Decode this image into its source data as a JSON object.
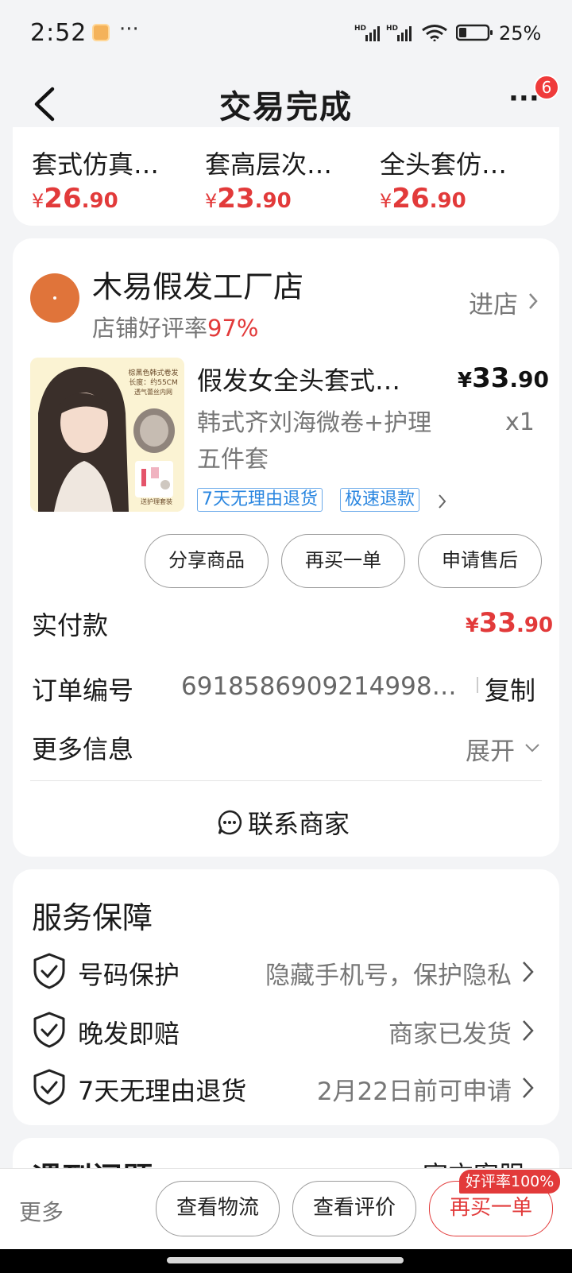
{
  "status_bar": {
    "time": "2:52",
    "overflow": "···",
    "network_1": "HD",
    "network_2": "HD",
    "battery": "25%"
  },
  "header": {
    "title": "交易完成",
    "more": "···",
    "badge_count": "6"
  },
  "recommendations": [
    {
      "name": "套式仿真…",
      "price_symbol": "¥",
      "price_int": "26",
      "price_dec": ".90"
    },
    {
      "name": "套高层次…",
      "price_symbol": "¥",
      "price_int": "23",
      "price_dec": ".90"
    },
    {
      "name": "全头套仿…",
      "price_symbol": "¥",
      "price_int": "26",
      "price_dec": ".90"
    }
  ],
  "shop": {
    "name": "木易假发工厂店",
    "rating_label": "店铺好评率",
    "rating_value": "97%",
    "enter_label": "进店"
  },
  "product": {
    "image_text": {
      "line1": "棕黑色韩式卷发",
      "line2": "长度：约55CM",
      "line3": "透气蕾丝内网",
      "footer": "送护理套装"
    },
    "title": "假发女全头套式…",
    "price_symbol": "¥",
    "price_int": "33",
    "price_dec": ".90",
    "spec": "韩式齐刘海微卷+护理五件套",
    "quantity": "x1",
    "tags": [
      "7天无理由退货",
      "极速退款"
    ]
  },
  "actions": {
    "share": "分享商品",
    "rebuy": "再买一单",
    "after_sale": "申请售后"
  },
  "order": {
    "paid_label": "实付款",
    "paid_symbol": "¥",
    "paid_int": "33",
    "paid_dec": ".90",
    "number_label": "订单编号",
    "number_value": "6918586909214998…",
    "copy_label": "复制",
    "more_label": "更多信息",
    "expand_label": "展开",
    "contact_label": "联系商家"
  },
  "services": {
    "title": "服务保障",
    "items": [
      {
        "name": "号码保护",
        "desc": "隐藏手机号，保护隐私"
      },
      {
        "name": "晚发即赔",
        "desc": "商家已发货"
      },
      {
        "name": "7天无理由退货",
        "desc": "2月22日前可申请"
      }
    ]
  },
  "problems": {
    "title": "遇到问题",
    "link": "官方客服"
  },
  "bottom_bar": {
    "more": "更多",
    "logistics": "查看物流",
    "reviews": "查看评价",
    "rebuy": "再买一单",
    "rebuy_badge": "好评率100%"
  },
  "colors": {
    "accent_red": "#e23a3a",
    "tag_blue": "#2a86e0",
    "shop_logo": "#e0743a"
  }
}
